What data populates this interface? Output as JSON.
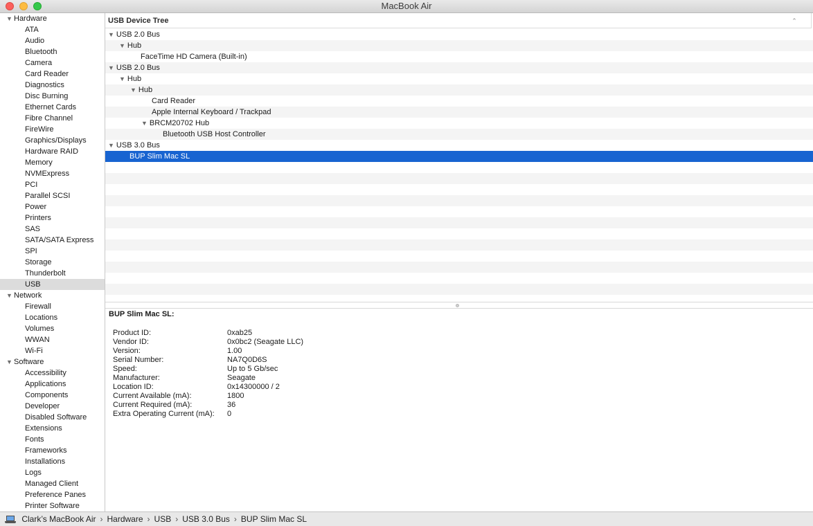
{
  "window": {
    "title": "MacBook Air"
  },
  "sidebar": {
    "sections": [
      {
        "label": "Hardware",
        "items": [
          "ATA",
          "Audio",
          "Bluetooth",
          "Camera",
          "Card Reader",
          "Diagnostics",
          "Disc Burning",
          "Ethernet Cards",
          "Fibre Channel",
          "FireWire",
          "Graphics/Displays",
          "Hardware RAID",
          "Memory",
          "NVMExpress",
          "PCI",
          "Parallel SCSI",
          "Power",
          "Printers",
          "SAS",
          "SATA/SATA Express",
          "SPI",
          "Storage",
          "Thunderbolt",
          "USB"
        ]
      },
      {
        "label": "Network",
        "items": [
          "Firewall",
          "Locations",
          "Volumes",
          "WWAN",
          "Wi-Fi"
        ]
      },
      {
        "label": "Software",
        "items": [
          "Accessibility",
          "Applications",
          "Components",
          "Developer",
          "Disabled Software",
          "Extensions",
          "Fonts",
          "Frameworks",
          "Installations",
          "Logs",
          "Managed Client",
          "Preference Panes",
          "Printer Software"
        ]
      }
    ],
    "selected": "USB"
  },
  "tree": {
    "header": "USB Device Tree",
    "rows": [
      {
        "label": "USB 2.0 Bus",
        "expanded": true
      },
      {
        "label": "Hub",
        "expanded": true
      },
      {
        "label": "FaceTime HD Camera (Built-in)"
      },
      {
        "label": "USB 2.0 Bus",
        "expanded": true
      },
      {
        "label": "Hub",
        "expanded": true
      },
      {
        "label": "Hub",
        "expanded": true
      },
      {
        "label": "Card Reader"
      },
      {
        "label": "Apple Internal Keyboard / Trackpad"
      },
      {
        "label": "BRCM20702 Hub",
        "expanded": true
      },
      {
        "label": "Bluetooth USB Host Controller"
      },
      {
        "label": "USB 3.0 Bus",
        "expanded": true
      },
      {
        "label": "BUP Slim Mac SL",
        "selected": true
      }
    ]
  },
  "detail": {
    "title": "BUP Slim Mac SL:",
    "properties": [
      {
        "label": "Product ID:",
        "value": "0xab25"
      },
      {
        "label": "Vendor ID:",
        "value": "0x0bc2  (Seagate LLC)"
      },
      {
        "label": "Version:",
        "value": "1.00"
      },
      {
        "label": "Serial Number:",
        "value": "NA7Q0D6S"
      },
      {
        "label": "Speed:",
        "value": "Up to 5 Gb/sec"
      },
      {
        "label": "Manufacturer:",
        "value": "Seagate"
      },
      {
        "label": "Location ID:",
        "value": "0x14300000 / 2"
      },
      {
        "label": "Current Available (mA):",
        "value": "1800"
      },
      {
        "label": "Current Required (mA):",
        "value": "36"
      },
      {
        "label": "Extra Operating Current (mA):",
        "value": "0"
      }
    ]
  },
  "breadcrumb": [
    "Clark’s MacBook Air",
    "Hardware",
    "USB",
    "USB 3.0 Bus",
    "BUP Slim Mac SL"
  ],
  "icons": {
    "computer": "laptop-icon",
    "disclosure_open": "disclosure-triangle-down-icon",
    "sort": "sort-chevron-up-icon",
    "separator": "chevron-right-icon"
  },
  "colors": {
    "selection": "#1864d1",
    "close": "#fc605c",
    "minimize": "#fdbc40",
    "zoom": "#34c84a"
  }
}
